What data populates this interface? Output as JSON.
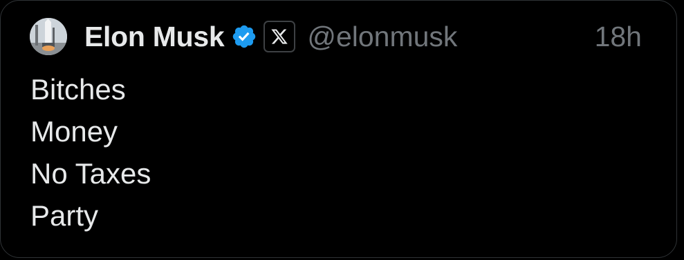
{
  "tweet": {
    "author_name": "Elon Musk",
    "handle": "@elonmusk",
    "timestamp": "18h",
    "avatar_icon": "rocket-launch-avatar",
    "verified_icon": "verified-badge-icon",
    "affiliate_icon": "x-logo-icon",
    "lines": [
      "Bitches",
      "Money",
      "No Taxes",
      "Party"
    ]
  },
  "colors": {
    "background": "#000000",
    "text_primary": "#e7e9ea",
    "text_secondary": "#71767b",
    "verified": "#1d9bf0",
    "border": "#2f3336"
  }
}
